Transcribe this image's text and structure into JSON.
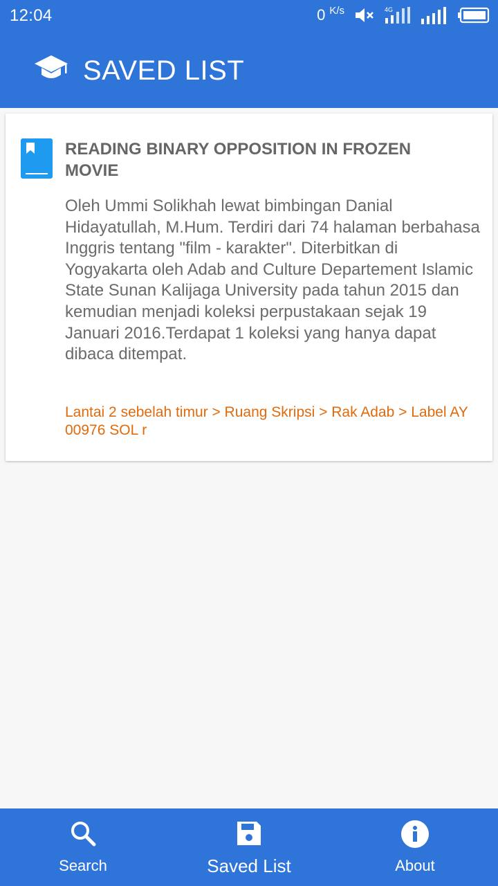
{
  "status_bar": {
    "time": "12:04",
    "net_speed_value": "0",
    "net_speed_unit": "K/s",
    "network_type": "4G"
  },
  "header": {
    "title": "SAVED LIST",
    "logo_icon": "graduation-cap-icon"
  },
  "saved_items": [
    {
      "icon": "bookmark-icon",
      "title": "READING BINARY OPPOSITION IN FROZEN MOVIE",
      "description": "Oleh Ummi Solikhah lewat bimbingan Danial Hidayatullah, M.Hum. Terdiri dari 74 halaman berbahasa Inggris tentang \"film - karakter\". Diterbitkan di Yogyakarta oleh Adab and Culture Departement Islamic State Sunan Kalijaga University pada tahun 2015 dan kemudian menjadi koleksi perpustakaan sejak 19 Januari 2016.Terdapat 1 koleksi yang hanya dapat dibaca ditempat.",
      "location": "Lantai 2 sebelah timur > Ruang Skripsi > Rak Adab  > Label AY 00976 SOL r"
    }
  ],
  "bottom_nav": {
    "search_label": "Search",
    "saved_label": "Saved List",
    "about_label": "About"
  },
  "colors": {
    "primary": "#2f74d9",
    "bookmark": "#1e9bf0",
    "location_text": "#e06a0c",
    "background": "#f7f7f7"
  }
}
